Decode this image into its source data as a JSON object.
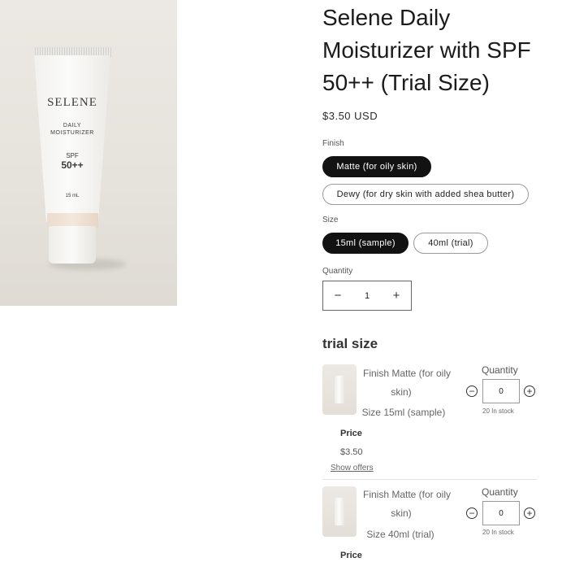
{
  "product": {
    "title": "Selene Daily Moisturizer with SPF 50++ (Trial Size)",
    "price": "$3.50 USD",
    "image_label": {
      "brand": "SELENE",
      "line1": "DAILY",
      "line2": "MOISTURIZER",
      "spf": "SPF",
      "spf_value": "50++",
      "size": "15 mL"
    }
  },
  "finish": {
    "label": "Finish",
    "options": [
      {
        "label": "Matte (for oily skin)",
        "selected": true
      },
      {
        "label": "Dewy (for dry skin with added shea butter)",
        "selected": false
      }
    ]
  },
  "size": {
    "label": "Size",
    "options": [
      {
        "label": "15ml (sample)",
        "selected": true
      },
      {
        "label": "40ml (trial)",
        "selected": false
      }
    ]
  },
  "quantity": {
    "label": "Quantity",
    "value": "1",
    "minus": "−",
    "plus": "+"
  },
  "bundle": {
    "title": "trial size",
    "variants": [
      {
        "finish_line1": "Finish Matte (for oily",
        "finish_line2": "skin)",
        "size_line": "Size 15ml (sample)",
        "quantity_label": "Quantity",
        "quantity_value": "0",
        "stock": "20 In stock",
        "price_label": "Price",
        "price_value": "$3.50",
        "show_offers": "Show offers"
      },
      {
        "finish_line1": "Finish Matte (for oily",
        "finish_line2": "skin)",
        "size_line": "Size 40ml (trial)",
        "quantity_label": "Quantity",
        "quantity_value": "0",
        "stock": "20 In stock",
        "price_label": "Price"
      }
    ]
  },
  "icons": {
    "minus": "−",
    "plus": "+"
  }
}
